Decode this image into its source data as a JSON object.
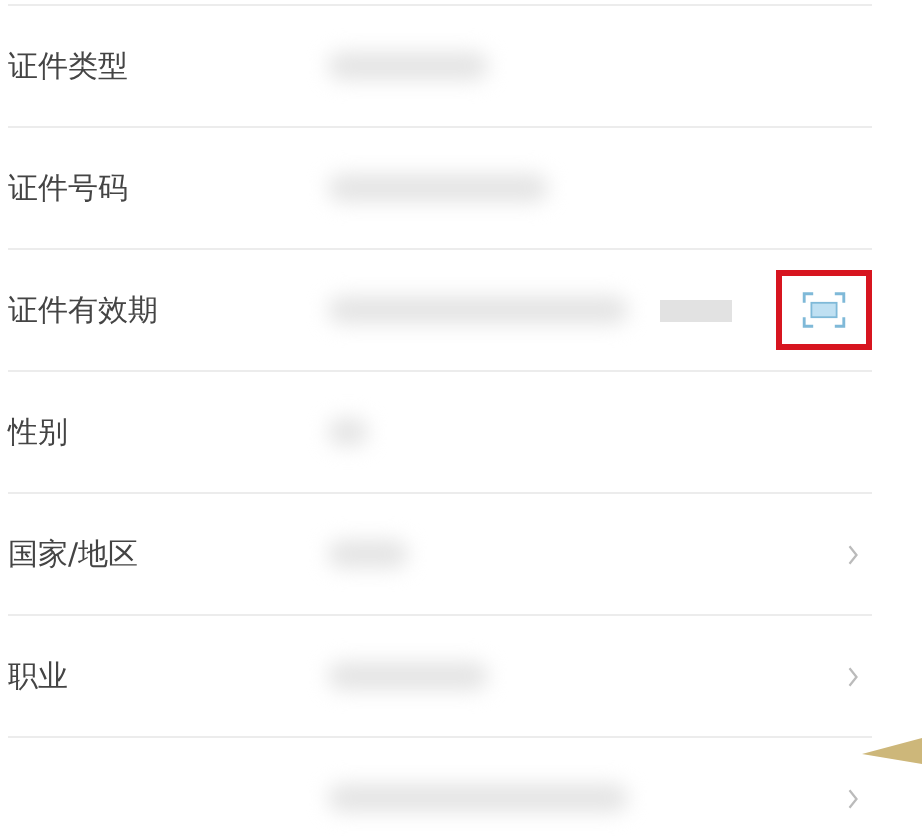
{
  "rows": [
    {
      "label": "证件类型",
      "kind": "plain"
    },
    {
      "label": "证件号码",
      "kind": "plain"
    },
    {
      "label": "证件有效期",
      "kind": "scan",
      "highlighted": true
    },
    {
      "label": "性别",
      "kind": "plain"
    },
    {
      "label": "国家/地区",
      "kind": "chevron"
    },
    {
      "label": "职业",
      "kind": "chevron"
    },
    {
      "kind": "chevron"
    }
  ]
}
